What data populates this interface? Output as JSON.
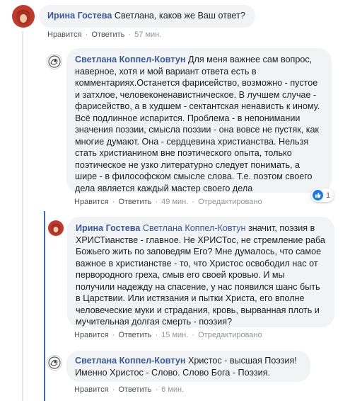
{
  "comments": [
    {
      "author": "Ирина Гостева",
      "text": "Светлана, каков же Ваш ответ?",
      "actions": {
        "like": "Нравится",
        "reply": "Ответить",
        "time": "57 мин."
      }
    },
    {
      "author": "Светлана Коппел-Ковтун",
      "text": "Для меня важнее сам вопрос, наверное, хотя и мой вариант ответа есть в комментариях.Останется фарисейство, возможно - пустое и затхлое, человеконенавистническое. В лучшем случае - фарисейство, а в худшем - сектантская ненависть к иному. Всё подлинное испарится. Проблема - в непонимании значения поэзии, смысла поэзии - она вовсе не пустяк, как многие думают. Она - сердцевина христианства. Нельзя стать христианином вне поэтического опыта, только поэтическое не узко литературно следует понимать, а шире - в философском смысле слова. Т.е. поэтом своего дела является каждый мастер своего дела",
      "reaction_count": "1",
      "actions": {
        "like": "Нравится",
        "reply": "Ответить",
        "time": "49 мин.",
        "edited": "Отредактировано"
      }
    },
    {
      "author": "Ирина Гостева",
      "mention": "Светлана Коппел-Ковтун",
      "text": " значит, поэзия в ХРИСТианстве - главное. Не ХРИСТос, не стремление раба Божьего жить по заповедям Его? Мне думалось, что самое важное в христианстве - то, что Христос освободил нас от первородного греха, смыв его своей кровью. И мы получили надежду на спасение, у нас появился шанс быть в Царствии. Или истязания и пытки Христа, его вполне человеческие муки и страдания, кровь, вырванная плоть и мучительная долгая смерть - поэзия?",
      "actions": {
        "like": "Нравится",
        "reply": "Ответить",
        "time": "15 мин.",
        "edited": "Отредактировано"
      }
    },
    {
      "author": "Светлана Коппел-Ковтун",
      "text": "Христос - высшая Поэзия! Именно Христос - Слово. Слово Бога - Поэзия.",
      "actions": {
        "like": "Нравится",
        "reply": "Ответить",
        "time": "6 мин."
      }
    }
  ],
  "separator": "·"
}
